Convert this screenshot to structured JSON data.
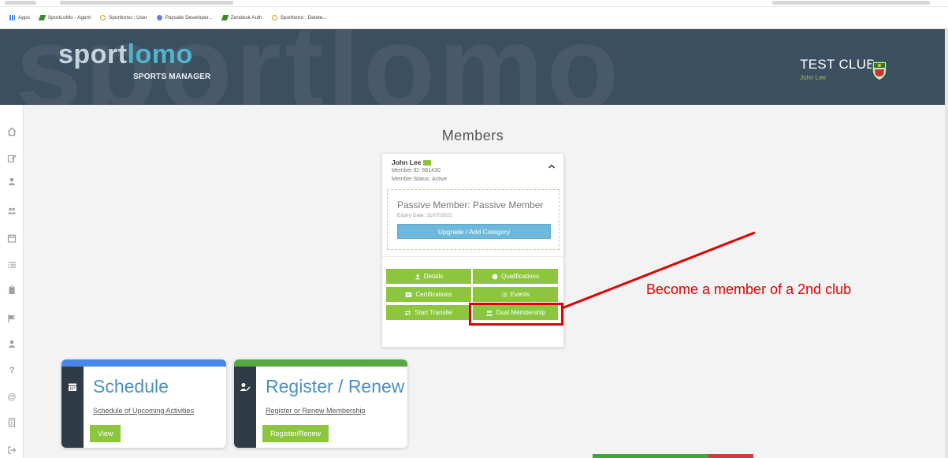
{
  "browser": {
    "bookmarks": [
      {
        "label": "Apps",
        "icon": "apps-grid-icon"
      },
      {
        "label": "SportLoMo - Agent",
        "icon": "sportlomo-icon"
      },
      {
        "label": "Sportlomo : User",
        "icon": "ring-icon"
      },
      {
        "label": "Paysafe Developer...",
        "icon": "paysafe-icon"
      },
      {
        "label": "Zendesk Auth",
        "icon": "sportlomo-icon"
      },
      {
        "label": "Sportlomo : Delete...",
        "icon": "ring-icon"
      }
    ]
  },
  "header": {
    "logo_part1": "sport",
    "logo_part2": "lomo",
    "logo_sub": "SPORTS MANAGER",
    "watermark": "sportlomo",
    "club_name": "TEST CLUB",
    "user_name": "John Lee"
  },
  "sidebar": {
    "icons": [
      "home-icon",
      "edit-icon",
      "user-icon",
      "users-icon",
      "calendar-icon",
      "list-icon",
      "clipboard-icon",
      "flag-icon",
      "person-icon",
      "help-icon",
      "at-icon",
      "building-icon",
      "logout-icon"
    ]
  },
  "page": {
    "title": "Members"
  },
  "member": {
    "name": "John Lee",
    "member_id": "Member ID: 661430",
    "status": "Member Status: Active",
    "plan_title": "Passive Member: Passive Member",
    "expiry": "Expiry Date: 31/07/2021",
    "upgrade_label": "Upgrade / Add Category",
    "buttons": {
      "details": "Details",
      "qualifications": "Qualifications",
      "certifications": "Certifications",
      "events": "Events",
      "start_transfer": "Start Transfer",
      "dual_membership": "Dual Membership"
    }
  },
  "annotation": {
    "callout": "Become a member of a 2nd club"
  },
  "tiles": {
    "schedule": {
      "title": "Schedule",
      "link": "Schedule of Upcoming Activities",
      "button": "View"
    },
    "register": {
      "title": "Register / Renew",
      "link": "Register or Renew Membership",
      "button": "Register/Renew"
    }
  },
  "colors": {
    "accent_green": "#8cc63f",
    "header_bg": "#3c4f61",
    "highlight_red": "#e00000",
    "title_blue": "#4a90c5"
  }
}
